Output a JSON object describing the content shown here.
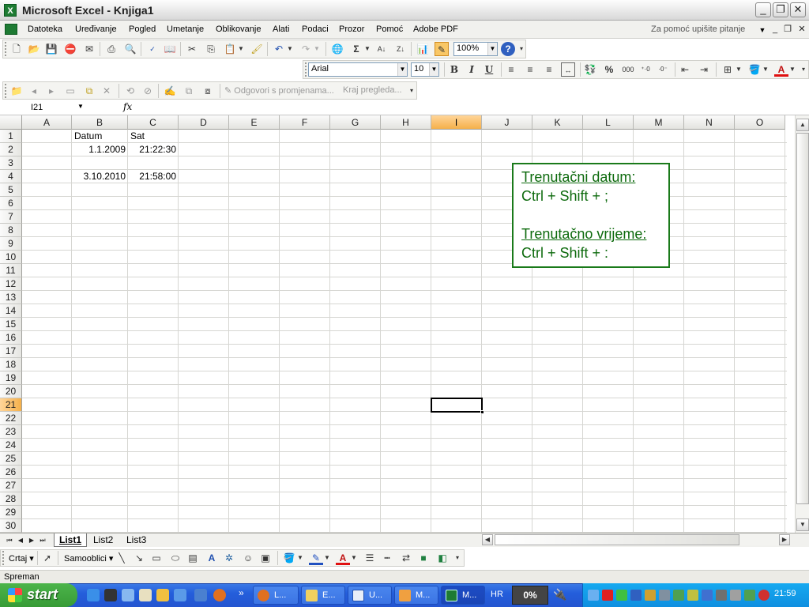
{
  "window": {
    "title": "Microsoft Excel - Knjiga1"
  },
  "menu": {
    "items": [
      "Datoteka",
      "Uređivanje",
      "Pogled",
      "Umetanje",
      "Oblikovanje",
      "Alati",
      "Podaci",
      "Prozor",
      "Pomoć",
      "Adobe PDF"
    ],
    "help_placeholder": "Za pomoć upišite pitanje"
  },
  "standard_toolbar": {
    "zoom": "100%"
  },
  "formatting_toolbar": {
    "font": "Arial",
    "size": "10",
    "bold": "B",
    "italic": "I",
    "underline": "U",
    "percent": "%",
    "thousands": "000"
  },
  "review_toolbar": {
    "reply_label": "Odgovori s promjenama...",
    "end_review_label": "Kraj pregleda..."
  },
  "formula_bar": {
    "name_box": "I21",
    "fx": "fx",
    "formula": ""
  },
  "sheet": {
    "columns": [
      "A",
      "B",
      "C",
      "D",
      "E",
      "F",
      "G",
      "H",
      "I",
      "J",
      "K",
      "L",
      "M",
      "N",
      "O"
    ],
    "rows": [
      "1",
      "2",
      "3",
      "4",
      "5",
      "6",
      "7",
      "8",
      "9",
      "10",
      "11",
      "12",
      "13",
      "14",
      "15",
      "16",
      "17",
      "18",
      "19",
      "20",
      "21",
      "22",
      "23",
      "24",
      "25",
      "26",
      "27",
      "28",
      "29",
      "30"
    ],
    "selected_cell": "I21",
    "cells": {
      "B1": "Datum",
      "C1": "Sat",
      "B2": "1.1.2009",
      "C2": "21:22:30",
      "B4": "3.10.2010",
      "C4": "21:58:00"
    }
  },
  "note": {
    "line1": "Trenutačni datum:",
    "line2": "Ctrl + Shift + ;",
    "line3": "Trenutačno vrijeme:",
    "line4": "Ctrl + Shift + :"
  },
  "sheet_tabs": [
    "List1",
    "List2",
    "List3"
  ],
  "active_tab": "List1",
  "drawing_toolbar": {
    "draw_label": "Crtaj",
    "autoshapes_label": "Samooblici"
  },
  "status_bar": {
    "text": "Spreman"
  },
  "taskbar": {
    "start_label": "start",
    "tasks": [
      "L...",
      "E...",
      "U...",
      "M...",
      "M..."
    ],
    "language": "HR",
    "percent": "0%",
    "clock": "21:59"
  },
  "colors": {
    "note_border": "#1a7a1a",
    "note_text": "#0d6a0d",
    "selected_header": "#f5b04a",
    "taskbar": "#245edb"
  }
}
